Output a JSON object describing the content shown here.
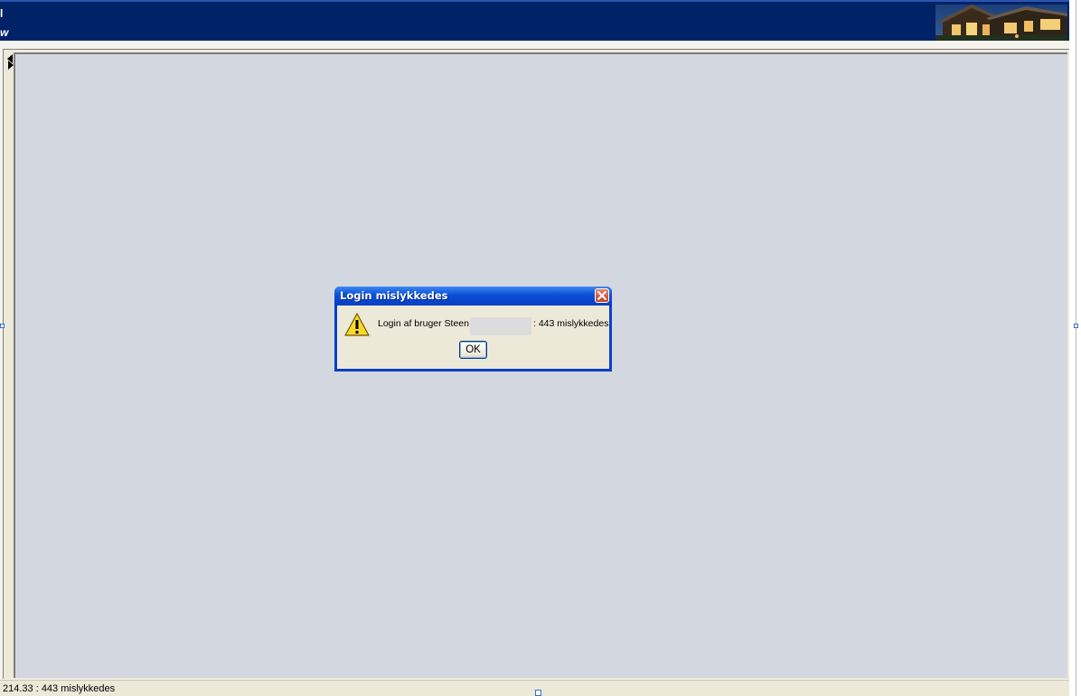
{
  "window": {
    "banner_fragment_top": "l",
    "banner_fragment_bottom": "w"
  },
  "dialog": {
    "title": "Login mislykkedes",
    "message_prefix": "Login af bruger Steen ti",
    "message_suffix": ": 443 mislykkedes",
    "ok_label": "OK",
    "icon": "warning-icon",
    "close_icon": "close-icon"
  },
  "statusbar": {
    "text": "214.33 : 443 mislykkedes"
  },
  "colors": {
    "banner": "#002266",
    "workspace": "#d3d8e0",
    "dialog_title": "#0a4fd8",
    "dialog_body": "#ece9d8"
  }
}
